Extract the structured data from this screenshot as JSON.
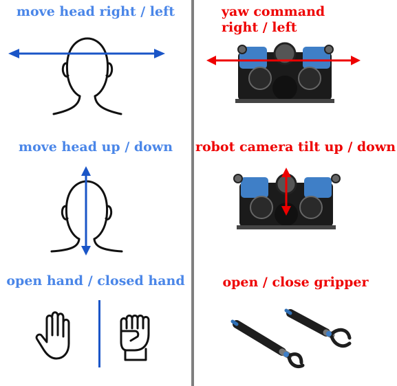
{
  "left_column": {
    "row1": {
      "label": "move head right / left"
    },
    "row2": {
      "label": "move head up / down"
    },
    "row3": {
      "label": "open hand / closed hand"
    }
  },
  "right_column": {
    "row1": {
      "label_line1": "yaw command",
      "label_line2": "right / left"
    },
    "row2": {
      "label": "robot camera tilt up / down"
    },
    "row3": {
      "label": "open / close gripper"
    }
  },
  "colors": {
    "human_text": "#4a86e8",
    "robot_text": "#ee0000",
    "divider": "#7f7f7f"
  }
}
